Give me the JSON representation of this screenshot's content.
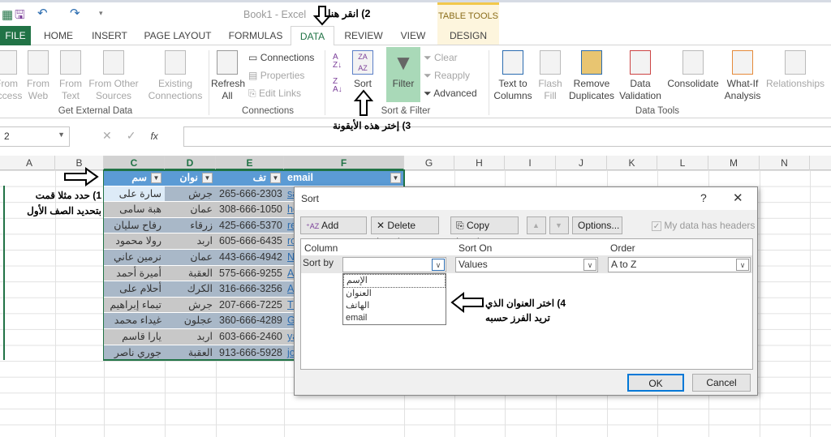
{
  "app": {
    "title": "Book1 - Excel",
    "table_tools": "TABLE TOOLS"
  },
  "tabs": [
    "FILE",
    "HOME",
    "INSERT",
    "PAGE LAYOUT",
    "FORMULAS",
    "DATA",
    "REVIEW",
    "VIEW",
    "DESIGN"
  ],
  "ribbon": {
    "get_external": {
      "label": "Get External Data",
      "items": [
        "From Access",
        "From Web",
        "From Text",
        "From Other Sources",
        "Existing Connections"
      ]
    },
    "connections": {
      "label": "Connections",
      "refresh": "Refresh All",
      "connections": "Connections",
      "properties": "Properties",
      "edit_links": "Edit Links"
    },
    "sort_filter": {
      "label": "Sort & Filter",
      "sort": "Sort",
      "filter": "Filter",
      "clear": "Clear",
      "reapply": "Reapply",
      "advanced": "Advanced"
    },
    "data_tools": {
      "label": "Data Tools",
      "items": [
        "Text to Columns",
        "Flash Fill",
        "Remove Duplicates",
        "Data Validation",
        "Consolidate",
        "What-If Analysis",
        "Relationships"
      ]
    }
  },
  "formula_bar": {
    "name_box": "2",
    "fx": "fx"
  },
  "columns": [
    "A",
    "B",
    "C",
    "D",
    "E",
    "F",
    "G",
    "H",
    "I",
    "J",
    "K",
    "L",
    "M",
    "N"
  ],
  "table": {
    "headers": [
      "سم",
      "نوان",
      "تف",
      "email"
    ],
    "rows": [
      [
        "سارة على",
        "جرش",
        "265-666-2303",
        "sa"
      ],
      [
        "هبة سامى",
        "عمان",
        "308-666-1050",
        "he"
      ],
      [
        "رفاح سليان",
        "زرقاء",
        "425-666-5370",
        "re"
      ],
      [
        "رولا محمود",
        "اربد",
        "605-666-6435",
        "ro"
      ],
      [
        "نرمين عاني",
        "عمان",
        "443-666-4942",
        "N"
      ],
      [
        "أميرة أحمد",
        "العقبة",
        "575-666-9255",
        "A"
      ],
      [
        "أحلام على",
        "الكرك",
        "316-666-3256",
        "A"
      ],
      [
        "تيماء إبراهيم",
        "جرش",
        "207-666-7225",
        "Ti"
      ],
      [
        "غيداء محمد",
        "عجلون",
        "360-666-4289",
        "G"
      ],
      [
        "يارا قاسم",
        "اربد",
        "603-666-2460",
        "ya"
      ],
      [
        "جوري ناصر",
        "العقبة",
        "913-666-5928",
        "jo"
      ]
    ]
  },
  "annotations": {
    "step1": "1) حدد مثلا قمت بتحديد الصف الأول",
    "step2": "2) انقر هنا",
    "step3": "3) إختر هذه الأيقونة",
    "step4a": "4) اختر العنوان الذي",
    "step4b": "تريد الفرز حسبه"
  },
  "dialog": {
    "title": "Sort",
    "help": "?",
    "close": "✕",
    "add_level": "Add Level",
    "delete_level": "Delete Level",
    "copy_level": "Copy Level",
    "options": "Options...",
    "headers_checkbox": "My data has headers",
    "headers_checked": true,
    "col_column": "Column",
    "col_sort_on": "Sort On",
    "col_order": "Order",
    "sort_by": "Sort by",
    "sort_by_value": "",
    "sort_on_value": "Values",
    "order_value": "A to Z",
    "dropdown_options": [
      "الإسم",
      "العنوان",
      "الهاتف",
      "email"
    ],
    "ok": "OK",
    "cancel": "Cancel"
  },
  "colors": {
    "excel_green": "#217346",
    "table_header": "#5b9bd5",
    "filter_active": "#a9d9b8"
  }
}
